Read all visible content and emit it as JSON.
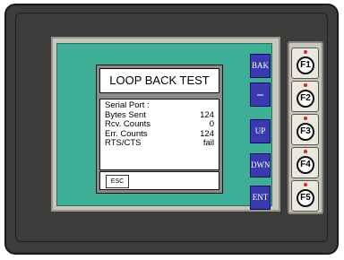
{
  "dialog": {
    "title": "LOOP BACK TEST",
    "rows": [
      {
        "label": "Serial Port :",
        "value": ""
      },
      {
        "label": "Bytes Sent",
        "value": "124"
      },
      {
        "label": "Rcv. Counts",
        "value": "0"
      },
      {
        "label": "Err. Counts",
        "value": "124"
      },
      {
        "label": "RTS/CTS",
        "value": "fail"
      }
    ],
    "esc_label": "ESC"
  },
  "side_buttons": [
    "BAK",
    "–",
    "UP",
    "DWN",
    "ENT"
  ],
  "function_keys": [
    "F1",
    "F2",
    "F3",
    "F4",
    "F5"
  ]
}
